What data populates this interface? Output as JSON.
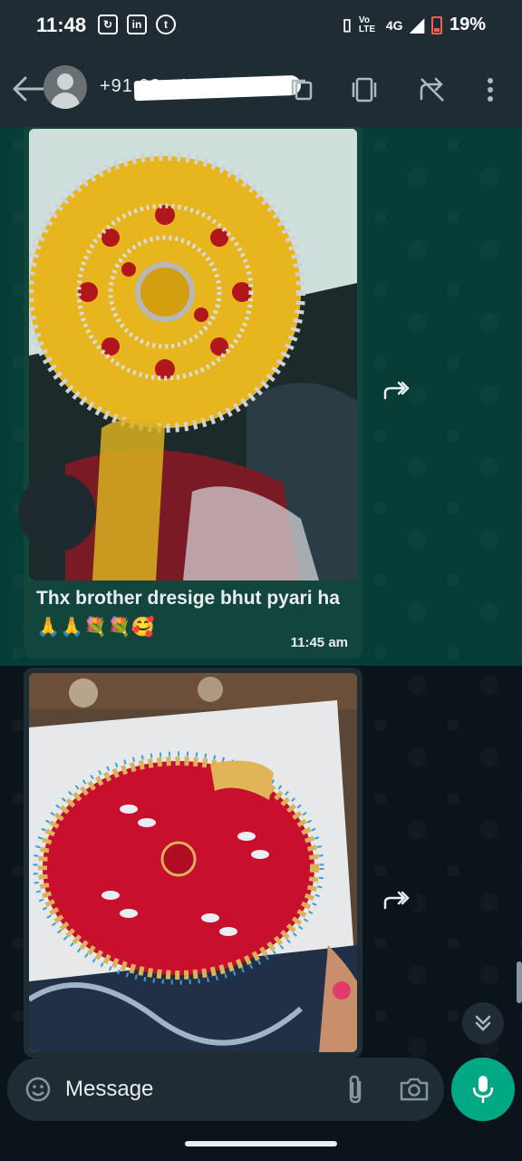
{
  "status_bar": {
    "time": "11:48",
    "left_icons": [
      "sync-icon",
      "linkedin-icon",
      "tinder-icon"
    ],
    "volte_label": "Vo LTE",
    "network": "4G",
    "battery": "19%",
    "battery_color": "#ff5b50"
  },
  "header": {
    "contact_name": "+91 93...0...300"
  },
  "messages": [
    {
      "caption": "Thx brother  dresige bhut pyari ha🙏🙏💐💐🥰",
      "time": "11:45 am",
      "selected": true
    },
    {
      "caption": "",
      "time": "",
      "selected": false
    }
  ],
  "composer": {
    "placeholder": "Message"
  },
  "colors": {
    "accent": "#00a884",
    "header_bg": "#1f2c34",
    "chat_bg": "#0b141a",
    "selected_bubble": "#12453c"
  }
}
